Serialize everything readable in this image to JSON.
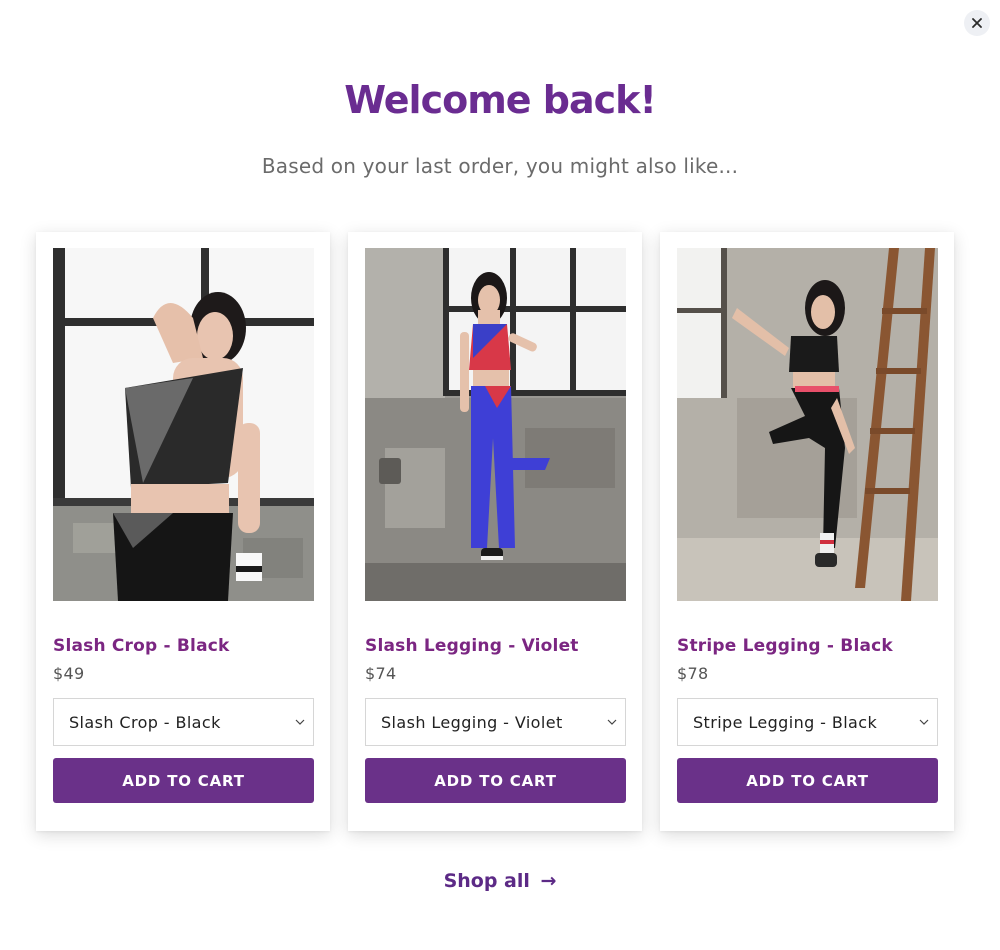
{
  "header": {
    "title": "Welcome back!",
    "subtitle": "Based on your last order, you might also like..."
  },
  "close_icon": "close-icon",
  "products": [
    {
      "name": "Slash Crop - Black",
      "price": "$49",
      "variant": "Slash Crop - Black",
      "button": "ADD TO CART",
      "image": "woman-in-black-sports-bra-photo"
    },
    {
      "name": "Slash Legging - Violet",
      "price": "$74",
      "variant": "Slash Legging - Violet",
      "button": "ADD TO CART",
      "image": "woman-in-violet-leggings-photo"
    },
    {
      "name": "Stripe Legging - Black",
      "price": "$78",
      "variant": "Stripe Legging - Black",
      "button": "ADD TO CART",
      "image": "woman-in-black-leggings-ladder-photo"
    }
  ],
  "footer": {
    "shop_all": "Shop all",
    "arrow": "→"
  },
  "colors": {
    "accent": "#6a2c91",
    "button": "#6a3189",
    "product_name": "#7b2682"
  }
}
